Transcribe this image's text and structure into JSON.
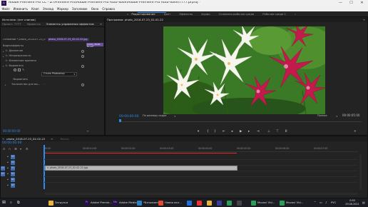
{
  "window": {
    "app_icon": "Pr",
    "title": "Adobe Premiere Pro CC - D:\\Premiere Pro\\Adobe Premiere Pro Auto-Save\\Adobe Premiere Pro Auto-Save\\7777.prproj *"
  },
  "menu": [
    "Файл",
    "Изменить",
    "Клип",
    "Эпизод",
    "Маркер",
    "Заголовок",
    "Окно",
    "Справка"
  ],
  "workspaces": [
    {
      "label": "Редактирование",
      "active": true
    },
    {
      "label": "Цвет",
      "active": false
    },
    {
      "label": "Эффекты",
      "active": false
    },
    {
      "label": "Аудио",
      "active": false
    },
    {
      "label": "Основная рабочая среда",
      "active": false
    },
    {
      "label": "Рабочая среда 1",
      "active": false
    }
  ],
  "source_panel": {
    "tab": "Источник: (нет клипов)",
    "tabs": [
      "Проект: 7777",
      "Эффекты",
      "Элементы управления эффектом"
    ],
    "clip_label": "Основной * photo_2018-07-23_02-...",
    "clip_link": "photo_2018-07-23_02-02-22.jpg",
    "section_title": "Видеоэффекты",
    "rows": [
      {
        "label": "Движение",
        "indent": 1
      },
      {
        "label": "Непрозрачность",
        "indent": 1
      },
      {
        "label": "Изменение времени",
        "indent": 1
      },
      {
        "label": "Выровнять",
        "indent": 1
      },
      {
        "label": "Выровнять",
        "indent": 2
      },
      {
        "label": "Количество для вы...",
        "indent": 2
      }
    ],
    "dropdown_value": "Стиль Photoshop",
    "timecode": "00:00:00:00"
  },
  "program": {
    "tab": "Программа: photo_2018-07-23_02-02-22",
    "timecode_left": "00:00:00:00",
    "fit": "По размеру кадра",
    "quality": "Полное",
    "timecode_right": "00:00:05:00"
  },
  "timeline": {
    "tab": "photo_2018-07-23_02-02-22",
    "side_label": "Ничто",
    "timecode": "00:00:00:00",
    "ruler": [
      "00:00",
      "00:00:01:00",
      "00:00:02:00",
      "00:00:03:00",
      "00:00:04:00",
      "00:00:05:00",
      "00:00:06:00",
      "00:00:07:00"
    ],
    "clip_label": "photo_2018-07-23_02-02-22.jpg",
    "tracks": [
      {
        "name": "V3"
      },
      {
        "name": "V2"
      },
      {
        "name": "V1"
      },
      {
        "name": "A1"
      },
      {
        "name": "A2"
      },
      {
        "name": "A3"
      }
    ],
    "track_prefix": [
      "",
      "",
      "V1",
      "A1",
      "",
      ""
    ]
  },
  "taskbar": {
    "apps": [
      {
        "label": "Загрузки",
        "color": "#e8b53a"
      },
      {
        "label": "Adobe Premie...",
        "color": "#2a0d4a",
        "glyph": "Pr"
      },
      {
        "label": "Adobe Media ...",
        "color": "#2a0d4a",
        "glyph": "Me"
      },
      {
        "label": "*Безымянн...",
        "color": "#2f7fc0"
      },
      {
        "label": "Новая вкл...",
        "color": "#e34a2f"
      },
      {
        "label": "Movavi Vid...",
        "color": "#2d9c57"
      },
      {
        "label": "Movavi Vid...",
        "color": "#2d9c57"
      }
    ],
    "lang": "РУС",
    "time": "0:50",
    "date": "29.06.2021"
  },
  "colors": {
    "accent_blue": "#2d8ceb",
    "selection_purple": "#6b4f9e",
    "playhead_red": "#e0302a",
    "clip_gray": "#b8b8b8"
  }
}
